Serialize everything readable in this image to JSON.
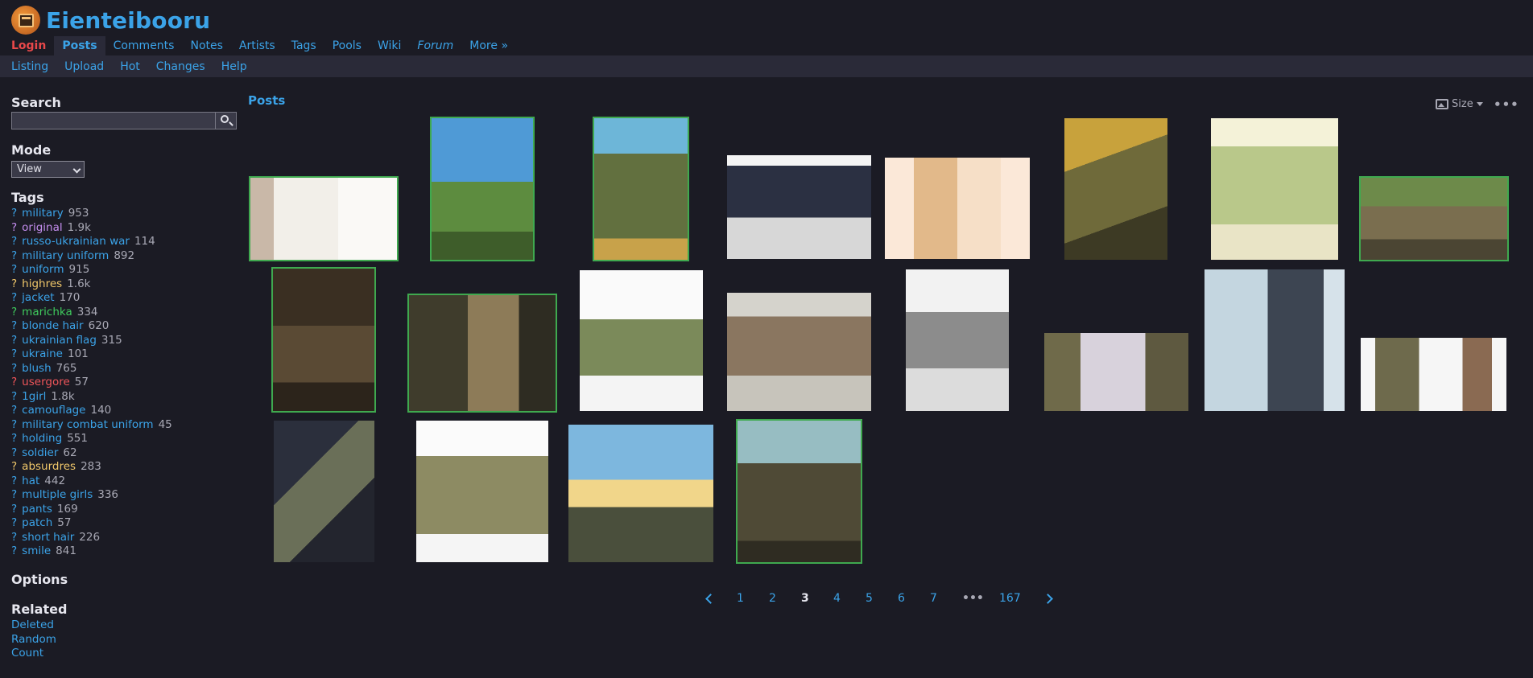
{
  "header": {
    "site_title": "Eienteibooru",
    "main_menu": [
      "Login",
      "Posts",
      "Comments",
      "Notes",
      "Artists",
      "Tags",
      "Pools",
      "Wiki",
      "Forum",
      "More »"
    ],
    "sub_menu": [
      "Listing",
      "Upload",
      "Hot",
      "Changes",
      "Help"
    ]
  },
  "sidebar": {
    "search_label": "Search",
    "search_value": "",
    "mode_label": "Mode",
    "mode_value": "View",
    "tags_label": "Tags",
    "tags": [
      {
        "name": "military",
        "count": "953",
        "category": "general"
      },
      {
        "name": "original",
        "count": "1.9k",
        "category": "copyright"
      },
      {
        "name": "russo-ukrainian war",
        "count": "114",
        "category": "general"
      },
      {
        "name": "military uniform",
        "count": "892",
        "category": "general"
      },
      {
        "name": "uniform",
        "count": "915",
        "category": "general"
      },
      {
        "name": "highres",
        "count": "1.6k",
        "category": "meta"
      },
      {
        "name": "jacket",
        "count": "170",
        "category": "general"
      },
      {
        "name": "marichka",
        "count": "334",
        "category": "character"
      },
      {
        "name": "blonde hair",
        "count": "620",
        "category": "general"
      },
      {
        "name": "ukrainian flag",
        "count": "315",
        "category": "general"
      },
      {
        "name": "ukraine",
        "count": "101",
        "category": "general"
      },
      {
        "name": "blush",
        "count": "765",
        "category": "general"
      },
      {
        "name": "usergore",
        "count": "57",
        "category": "artist"
      },
      {
        "name": "1girl",
        "count": "1.8k",
        "category": "general"
      },
      {
        "name": "camouflage",
        "count": "140",
        "category": "general"
      },
      {
        "name": "military combat uniform",
        "count": "45",
        "category": "general"
      },
      {
        "name": "holding",
        "count": "551",
        "category": "general"
      },
      {
        "name": "soldier",
        "count": "62",
        "category": "general"
      },
      {
        "name": "absurdres",
        "count": "283",
        "category": "meta"
      },
      {
        "name": "hat",
        "count": "442",
        "category": "general"
      },
      {
        "name": "multiple girls",
        "count": "336",
        "category": "general"
      },
      {
        "name": "pants",
        "count": "169",
        "category": "general"
      },
      {
        "name": "patch",
        "count": "57",
        "category": "general"
      },
      {
        "name": "short hair",
        "count": "226",
        "category": "general"
      },
      {
        "name": "smile",
        "count": "841",
        "category": "general"
      }
    ],
    "tag_prefix": "?",
    "options_label": "Options",
    "related_label": "Related",
    "related": [
      "Deleted",
      "Random",
      "Count"
    ]
  },
  "posts": {
    "title": "Posts",
    "size_label": "Size",
    "more_label": "•••"
  },
  "paginator": {
    "pages": [
      "1",
      "2",
      "3",
      "4",
      "5",
      "6",
      "7",
      "•••",
      "167"
    ],
    "current": "3"
  },
  "colors": {
    "background": "#1b1b24",
    "link": "#3ba3e8",
    "login": "#e8484a",
    "copyright_tag": "#c58ef0",
    "meta_tag": "#f0c76a",
    "character_tag": "#3fcb5d",
    "artist_tag": "#f0555a",
    "flagged_border": "#3fa94f"
  }
}
